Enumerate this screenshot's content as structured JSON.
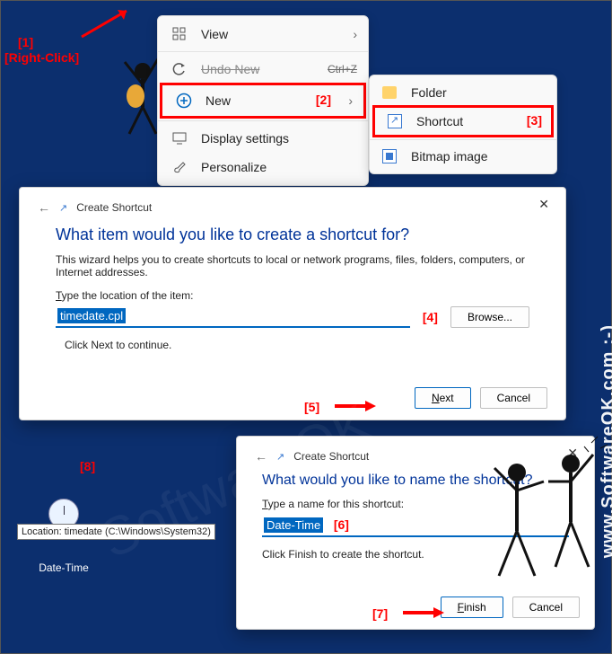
{
  "context_menu": {
    "view": "View",
    "undo": "Undo New",
    "undo_accel": "Ctrl+Z",
    "new": "New",
    "display": "Display settings",
    "personalize": "Personalize"
  },
  "submenu": {
    "folder": "Folder",
    "shortcut": "Shortcut",
    "bitmap": "Bitmap image"
  },
  "annotations": {
    "a1": "[1]",
    "a1b": "[Right-Click]",
    "a2": "[2]",
    "a3": "[3]",
    "a4": "[4]",
    "a5": "[5]",
    "a6": "[6]",
    "a7": "[7]",
    "a8": "[8]"
  },
  "dialog1": {
    "crumb": "Create Shortcut",
    "heading": "What item would you like to create a shortcut for?",
    "help": "This wizard helps you to create shortcuts to local or network programs, files, folders, computers, or Internet addresses.",
    "label_pre": "T",
    "label_rest": "ype the location of the item:",
    "value": "timedate.cpl",
    "browse": "Browse...",
    "hint": "Click Next to continue.",
    "next": "Next",
    "cancel": "Cancel"
  },
  "dialog2": {
    "crumb": "Create Shortcut",
    "heading": "What would you like to name the shortcut?",
    "label_pre": "T",
    "label_rest": "ype a name for this shortcut:",
    "value": "Date-Time",
    "hint": "Click Finish to create the shortcut.",
    "finish": "Finish",
    "cancel": "Cancel"
  },
  "desktop": {
    "icon_label": "Date-Time",
    "tooltip": "Location: timedate (C:\\Windows\\System32)"
  },
  "watermark": "www.SoftwareOK.com :-)"
}
